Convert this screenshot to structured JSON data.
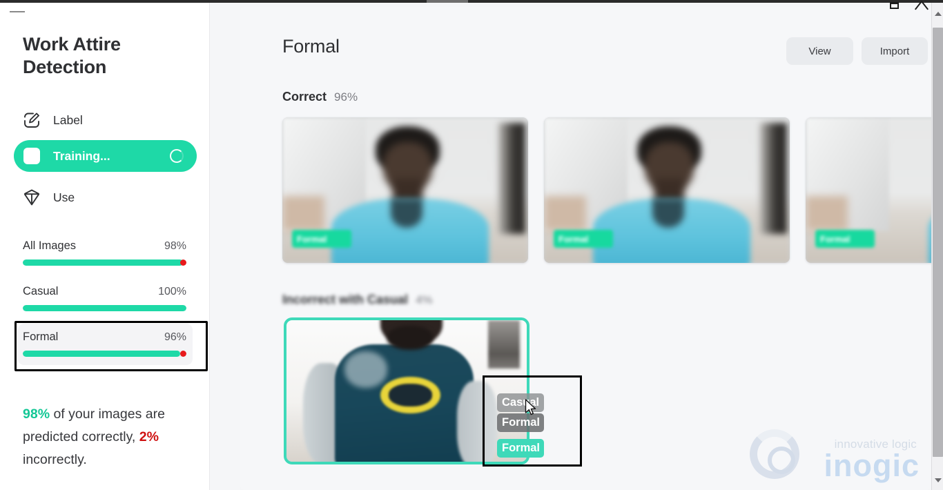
{
  "window": {
    "minimize_icon": "minimize-icon",
    "maximize_icon": "maximize-icon",
    "close_icon": "close-icon"
  },
  "sidebar": {
    "app_title": "Work Attire Detection",
    "nav": [
      {
        "label": "Label",
        "icon": "pencil-square-icon",
        "active": false
      },
      {
        "label": "Training...",
        "icon": "white-square-icon",
        "active": true,
        "spinner": "loading-spinner-icon"
      },
      {
        "label": "Use",
        "icon": "cube-icon",
        "active": false
      }
    ],
    "metrics": [
      {
        "name": "All Images",
        "value": "98%",
        "fill_pct": 98,
        "error_pct": 2
      },
      {
        "name": "Casual",
        "value": "100%",
        "fill_pct": 100,
        "error_pct": 0
      },
      {
        "name": "Formal",
        "value": "96%",
        "fill_pct": 96,
        "error_pct": 4,
        "selected": true
      }
    ],
    "summary": {
      "good_pct": "98%",
      "good_text": " of your images are predicted correctly,",
      "bad_pct": "2%",
      "bad_text": " incorrectly."
    }
  },
  "main": {
    "page_title": "Formal",
    "buttons": {
      "view": "View",
      "import": "Import"
    },
    "sections": [
      {
        "name": "Correct",
        "pct": "96%",
        "blurred": false,
        "thumbs": [
          {
            "badge": "Formal",
            "badge_blurred": true
          },
          {
            "badge": "Formal",
            "badge_blurred": true
          },
          {
            "badge": "Formal",
            "badge_blurred": true
          }
        ]
      },
      {
        "name": "Incorrect with Casual",
        "pct": "4%",
        "blurred": true,
        "thumbs": [
          {
            "badge": "Formal",
            "selected": true
          }
        ]
      }
    ],
    "dropdown": {
      "options": [
        {
          "label": "Casual",
          "hovered": true
        },
        {
          "label": "Formal",
          "hovered": false
        }
      ],
      "current_badge": "Formal"
    }
  },
  "watermark": {
    "tagline": "innovative logic",
    "wordmark": "inogic",
    "logo_icon": "inogic-bulb-ring-icon"
  },
  "colors": {
    "accent_green": "#1ed9a7",
    "selection_teal": "#3ed9b9",
    "error_red": "#e8191b",
    "summary_bad": "#cf1111",
    "panel_bg": "#f5f6f8",
    "sidebar_bg": "#ffffff",
    "button_bg": "#e9ebee"
  }
}
